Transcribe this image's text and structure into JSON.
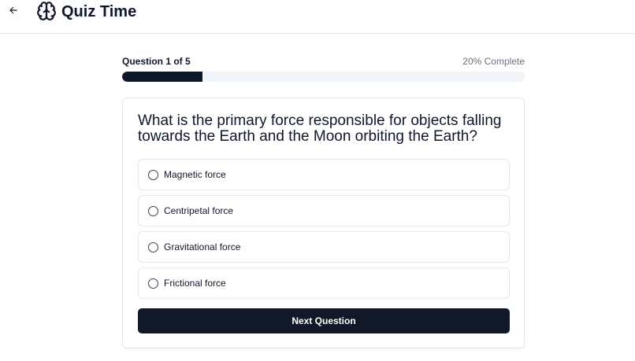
{
  "header": {
    "back_icon": "arrow-left-icon",
    "logo_icon": "brain-icon",
    "title": "Quiz Time"
  },
  "progress": {
    "question_label": "Question 1 of 5",
    "percent_label": "20% Complete",
    "fraction": 0.2
  },
  "quiz": {
    "question": "What is the primary force responsible for objects falling towards the Earth and the Moon orbiting the Earth?",
    "options": [
      {
        "label": "Magnetic force"
      },
      {
        "label": "Centripetal force"
      },
      {
        "label": "Gravitational force"
      },
      {
        "label": "Frictional force"
      }
    ],
    "next_label": "Next Question"
  },
  "colors": {
    "primary": "#0f172a",
    "track": "#f1f5f9",
    "border": "#e5e7eb",
    "muted": "#6b7280"
  }
}
